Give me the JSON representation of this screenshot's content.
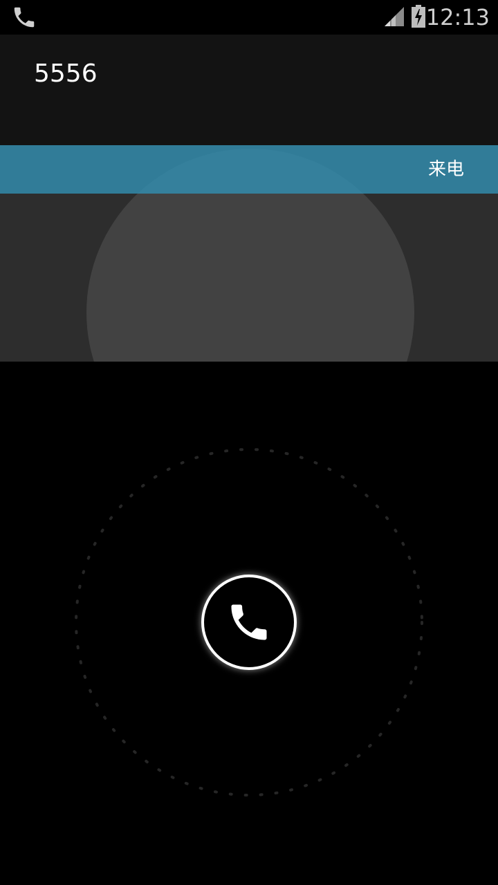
{
  "status_bar": {
    "time": "12:13",
    "notification_icon": "phone-icon",
    "signal_icon": "signal-icon",
    "battery_icon": "battery-charging-icon"
  },
  "caller": {
    "number": "5556"
  },
  "call_state": {
    "label": "来电"
  },
  "answer_control": {
    "icon": "phone-icon"
  },
  "colors": {
    "call_state_bar": "#338bac",
    "photo_background": "#2d2d2d",
    "header_background": "#131313"
  }
}
